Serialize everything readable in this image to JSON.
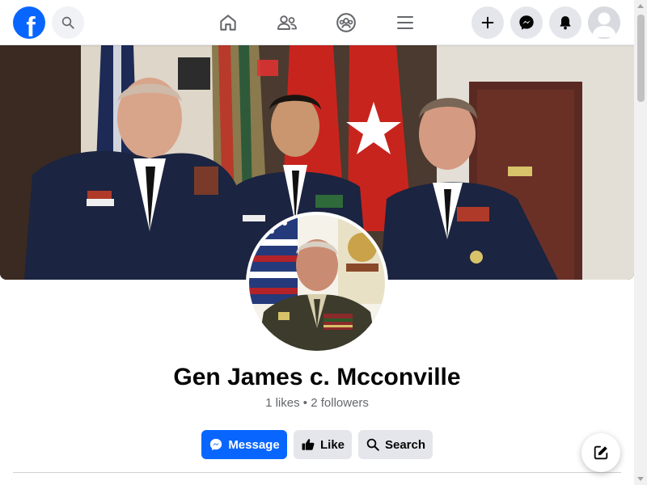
{
  "profile": {
    "name": "Gen James c. Mcconville",
    "likes": "1 likes",
    "separator": "•",
    "followers": "2 followers"
  },
  "actions": {
    "message_label": "Message",
    "like_label": "Like",
    "search_label": "Search"
  },
  "header": {
    "logo": "facebook-logo-icon",
    "left_icons": [
      "search-icon"
    ],
    "center_icons": [
      "home-icon",
      "friends-icon",
      "groups-icon",
      "menu-icon"
    ],
    "right_icons": [
      "plus-icon",
      "messenger-icon",
      "bell-icon",
      "avatar"
    ]
  },
  "colors": {
    "brand_blue": "#0866ff",
    "button_gray": "#e4e6eb",
    "text_primary": "#050505",
    "text_secondary": "#65676b"
  }
}
